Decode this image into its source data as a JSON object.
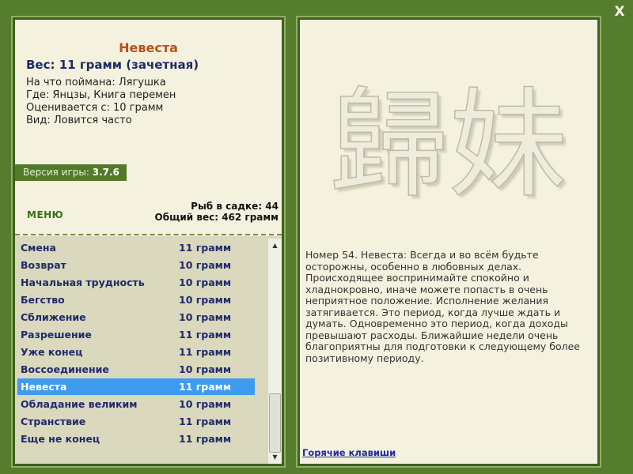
{
  "window": {
    "close_symbol": "X"
  },
  "fish": {
    "name": "Невеста",
    "weight": "Вес: 11 грамм (зачетная)",
    "info": [
      "На что поймана: Лягушка",
      "Где: Янцзы, Книга перемен",
      "Оценивается с: 10 грамм",
      "Вид: Ловится часто"
    ]
  },
  "version": {
    "label": "Версия игры:",
    "value": "3.7.6"
  },
  "menu": {
    "label": "МЕНЮ"
  },
  "stats": {
    "fish_count": "Рыб в садке: 44",
    "total_weight": "Общий вес: 462 грамм"
  },
  "list": {
    "items": [
      {
        "name": "Смена",
        "weight": "11 грамм"
      },
      {
        "name": "Возврат",
        "weight": "10 грамм"
      },
      {
        "name": "Начальная трудность",
        "weight": "10 грамм"
      },
      {
        "name": "Бегство",
        "weight": "10 грамм"
      },
      {
        "name": "Сближение",
        "weight": "10 грамм"
      },
      {
        "name": "Разрешение",
        "weight": "11 грамм"
      },
      {
        "name": "Уже конец",
        "weight": "11 грамм"
      },
      {
        "name": "Воссоединение",
        "weight": "10 грамм"
      },
      {
        "name": "Невеста",
        "weight": "11 грамм"
      },
      {
        "name": "Обладание великим",
        "weight": "10 грамм"
      },
      {
        "name": "Странствие",
        "weight": "11 грамм"
      },
      {
        "name": "Еще не конец",
        "weight": "11 грамм"
      }
    ],
    "selected_index": 8
  },
  "hexagram": {
    "glyphs": "歸妹"
  },
  "description": "Номер 54. Невеста: Всегда и во всём будьте осторожны, особенно в любовных делах. Происходящее воспринимайте спокойно и хладнокровно, иначе можете попасть в очень неприятное положение. Исполнение желания затягивается. Это период, когда лучше ждать и думать. Одновременно это период, когда доходы превышают расходы. Ближайшие недели очень благоприятны для подготовки к следующему более позитивному периоду.",
  "hotkeys": {
    "label": "Горячие клавиши"
  },
  "colors": {
    "background": "#567d2e",
    "panel": "#f4f2df",
    "selected": "#3d9cf0",
    "text_accent": "#b8501f"
  }
}
